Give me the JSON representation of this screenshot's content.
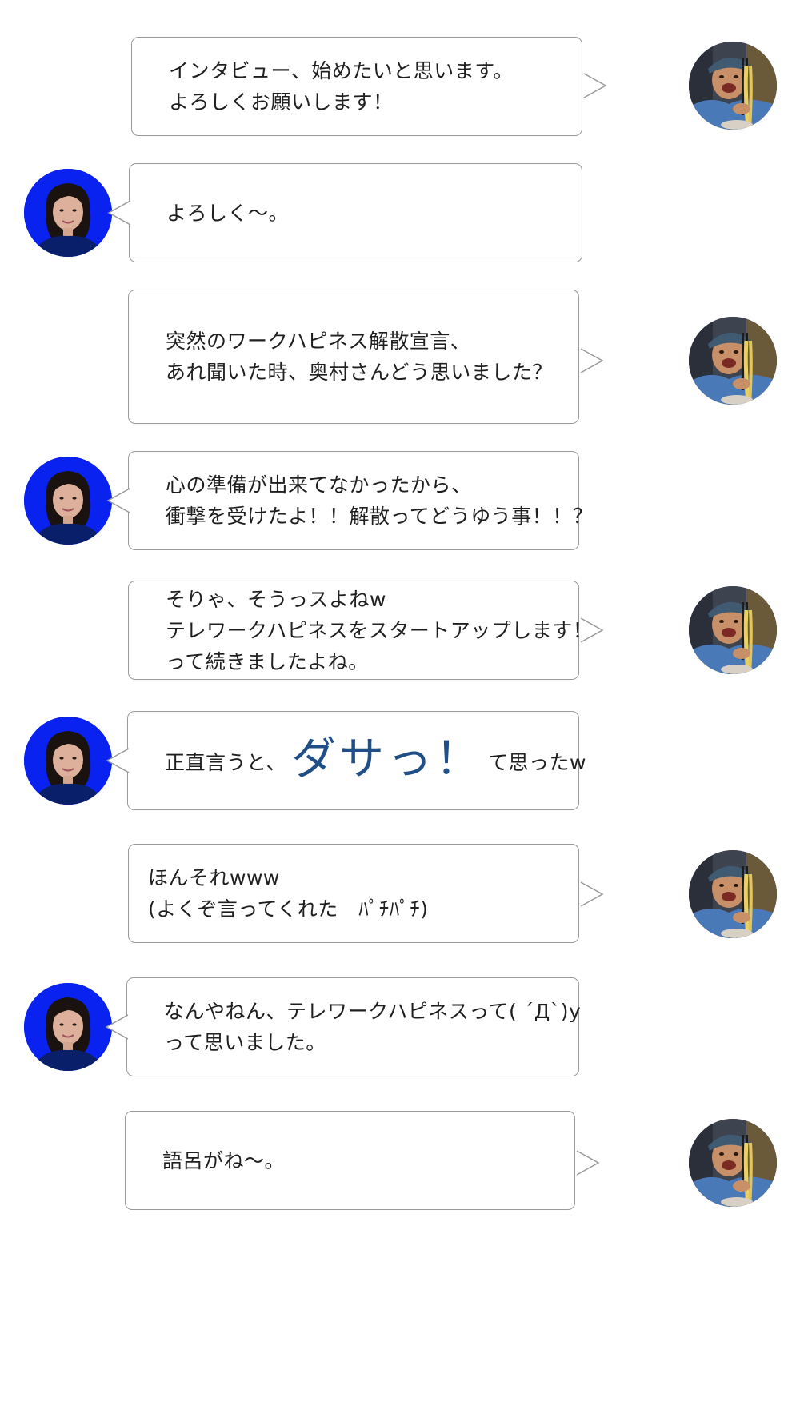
{
  "messages": [
    {
      "speaker": "interviewer",
      "lines": [
        "インタビュー、始めたいと思います。",
        "よろしくお願いします！"
      ]
    },
    {
      "speaker": "okumura",
      "lines": [
        "よろしく〜。"
      ]
    },
    {
      "speaker": "interviewer",
      "lines": [
        "突然のワークハピネス解散宣言、",
        "あれ聞いた時、奥村さんどう思いました？"
      ]
    },
    {
      "speaker": "okumura",
      "lines": [
        "心の準備が出来てなかったから、",
        "衝撃を受けたよ！！解散ってどうゆう事！！？"
      ]
    },
    {
      "speaker": "interviewer",
      "lines": [
        "そりゃ、そうっスよねw",
        "テレワークハピネスをスタートアップします！",
        "って続きましたよね。"
      ]
    },
    {
      "speaker": "okumura",
      "before": "正直言うと、",
      "emphasis": "ダサっ！",
      "after": "て思ったw"
    },
    {
      "speaker": "interviewer",
      "lines": [
        "ほんそれwww",
        "(よくぞ言ってくれた　ﾊﾟﾁﾊﾟﾁ)"
      ]
    },
    {
      "speaker": "okumura",
      "lines": [
        "なんやねん、テレワークハピネスって( ´Д`)y",
        "って思いました。"
      ]
    },
    {
      "speaker": "interviewer",
      "lines": [
        "語呂がね〜。"
      ]
    }
  ],
  "avatars": {
    "interviewer": {
      "icon": "interviewer-avatar-photo",
      "background": "#3a4150"
    },
    "okumura": {
      "icon": "okumura-avatar-photo",
      "background": "#0a22f0"
    }
  },
  "colors": {
    "bubble_border": "#9a9a9a",
    "emphasis_text": "#1f4f86",
    "text": "#1f1f1f"
  }
}
